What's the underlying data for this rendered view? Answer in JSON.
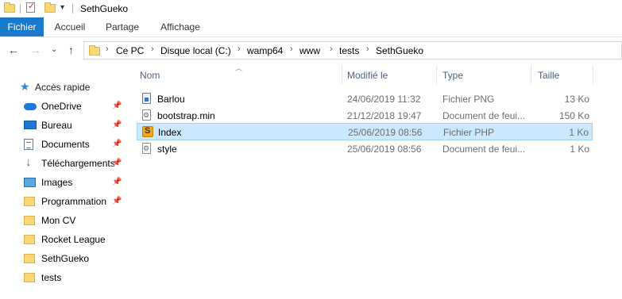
{
  "window": {
    "title": "SethGueko"
  },
  "ribbon": {
    "tabs": [
      {
        "label": "Fichier",
        "active": true
      },
      {
        "label": "Accueil",
        "active": false
      },
      {
        "label": "Partage",
        "active": false
      },
      {
        "label": "Affichage",
        "active": false
      }
    ]
  },
  "address": {
    "crumbs": [
      "Ce PC",
      "Disque local (C:)",
      "wamp64",
      "www",
      "tests",
      "SethGueko"
    ]
  },
  "navpane": {
    "quick_access": "Accès rapide",
    "items": [
      {
        "label": "OneDrive",
        "icon": "onedrive-icon",
        "pinned": true
      },
      {
        "label": "Bureau",
        "icon": "desktop-icon",
        "pinned": true
      },
      {
        "label": "Documents",
        "icon": "documents-icon",
        "pinned": true
      },
      {
        "label": "Téléchargements",
        "icon": "download-icon",
        "pinned": true
      },
      {
        "label": "Images",
        "icon": "pictures-icon",
        "pinned": true
      },
      {
        "label": "Programmation",
        "icon": "folder-icon",
        "pinned": true
      },
      {
        "label": "Mon CV",
        "icon": "folder-icon",
        "pinned": false
      },
      {
        "label": "Rocket League",
        "icon": "folder-icon",
        "pinned": false
      },
      {
        "label": "SethGueko",
        "icon": "folder-icon",
        "pinned": false
      },
      {
        "label": "tests",
        "icon": "folder-icon",
        "pinned": false
      }
    ]
  },
  "columns": {
    "name": "Nom",
    "modified": "Modifié le",
    "type": "Type",
    "size": "Taille"
  },
  "files": [
    {
      "name": "Barlou",
      "modified": "24/06/2019 11:32",
      "type": "Fichier PNG",
      "size": "13 Ko",
      "icon": "png-file-icon",
      "selected": false
    },
    {
      "name": "bootstrap.min",
      "modified": "21/12/2018 19:47",
      "type": "Document de feui...",
      "size": "150 Ko",
      "icon": "css-file-icon",
      "selected": false
    },
    {
      "name": "Index",
      "modified": "25/06/2019 08:56",
      "type": "Fichier PHP",
      "size": "1 Ko",
      "icon": "php-file-icon",
      "selected": true
    },
    {
      "name": "style",
      "modified": "25/06/2019 08:56",
      "type": "Document de feui...",
      "size": "1 Ko",
      "icon": "css-file-icon",
      "selected": false
    }
  ],
  "colors": {
    "accent": "#1979ca",
    "selection": "#cce8ff"
  }
}
